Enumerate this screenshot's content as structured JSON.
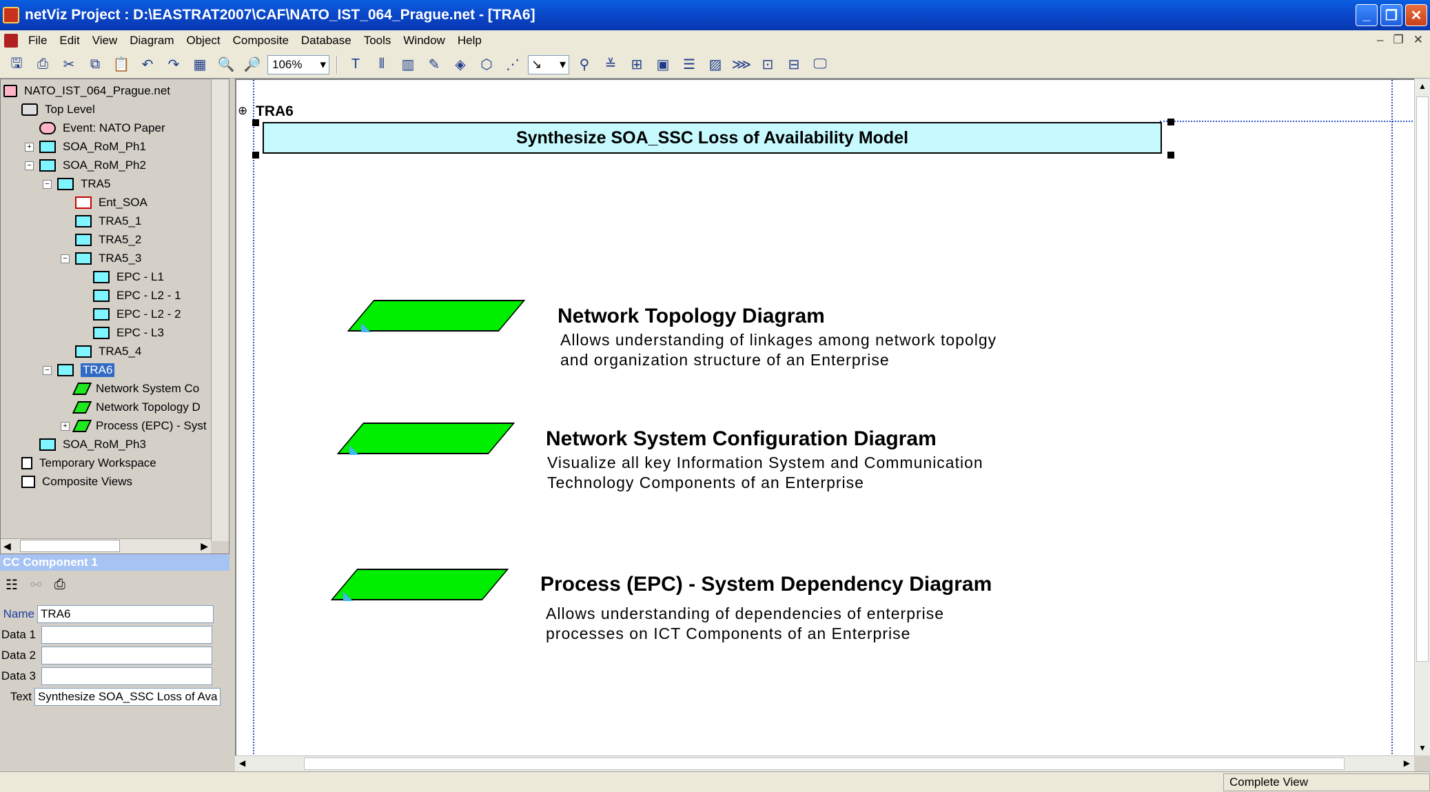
{
  "window": {
    "title": "netViz Project : D:\\EASTRAT2007\\CAF\\NATO_IST_064_Prague.net - [TRA6]"
  },
  "menu": [
    "File",
    "Edit",
    "View",
    "Diagram",
    "Object",
    "Composite",
    "Database",
    "Tools",
    "Window",
    "Help"
  ],
  "toolbar": {
    "zoom": "106%"
  },
  "tree": {
    "root": "NATO_IST_064_Prague.net",
    "items": [
      "Top Level",
      "Event: NATO Paper",
      "SOA_RoM_Ph1",
      "SOA_RoM_Ph2",
      "TRA5",
      "Ent_SOA",
      "TRA5_1",
      "TRA5_2",
      "TRA5_3",
      "EPC - L1",
      "EPC - L2 - 1",
      "EPC - L2 - 2",
      "EPC - L3",
      "TRA5_4",
      "TRA6",
      "Network System  Co",
      "Network Topology D",
      "Process (EPC) - Syst",
      "SOA_RoM_Ph3",
      "Temporary Workspace",
      "Composite Views"
    ]
  },
  "props": {
    "header": "CC Component 1",
    "labels": {
      "name": "Name",
      "d1": "Data 1",
      "d2": "Data 2",
      "d3": "Data 3",
      "text": "Text"
    },
    "name": "TRA6",
    "data1": "",
    "data2": "",
    "data3": "",
    "text": "Synthesize SOA_SSC Loss of Ava"
  },
  "canvas": {
    "label": "TRA6",
    "banner": "Synthesize SOA_SSC Loss of Availability Model",
    "diagrams": [
      {
        "title": "Network Topology Diagram",
        "line1": "Allows understanding of linkages among network topolgy",
        "line2": "and organization structure of an Enterprise"
      },
      {
        "title": "Network System  Configuration Diagram",
        "line1": "Visualize all key Information System and Communication",
        "line2": "Technology Components of an Enterprise"
      },
      {
        "title": "Process (EPC) - System Dependency Diagram",
        "line1": "Allows understanding of dependencies of enterprise",
        "line2": "processes on ICT Components of an Enterprise"
      }
    ]
  },
  "status": {
    "view": "Complete View"
  }
}
